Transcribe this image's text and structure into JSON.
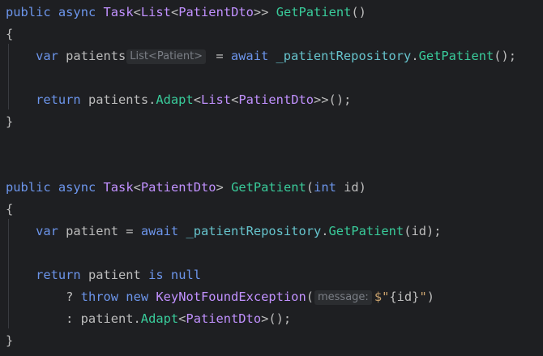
{
  "editor": {
    "lines": [
      [
        [
          "c-kw",
          "public"
        ],
        [
          "c-ns",
          " "
        ],
        [
          "c-kw",
          "async"
        ],
        [
          "c-ns",
          " "
        ],
        [
          "c-type",
          "Task"
        ],
        [
          "c-ns",
          "<"
        ],
        [
          "c-type",
          "List"
        ],
        [
          "c-ns",
          "<"
        ],
        [
          "c-type",
          "PatientDto"
        ],
        [
          "c-ns",
          ">> "
        ],
        [
          "c-method",
          "GetPatient"
        ],
        [
          "c-ns",
          "()"
        ]
      ],
      [
        [
          "c-ns",
          "{"
        ]
      ],
      [
        [
          "c-ns",
          "    "
        ],
        [
          "c-kw",
          "var"
        ],
        [
          "c-ns",
          " patients"
        ],
        [
          "hint",
          "List<Patient>"
        ],
        [
          "c-ns",
          " = "
        ],
        [
          "c-kw",
          "await"
        ],
        [
          "c-ns",
          " "
        ],
        [
          "c-field",
          "_patientRepository"
        ],
        [
          "c-ns",
          "."
        ],
        [
          "c-method",
          "GetPatient"
        ],
        [
          "c-ns",
          "();"
        ]
      ],
      [
        [
          "c-ns",
          ""
        ]
      ],
      [
        [
          "c-ns",
          "    "
        ],
        [
          "c-kw",
          "return"
        ],
        [
          "c-ns",
          " patients."
        ],
        [
          "c-method",
          "Adapt"
        ],
        [
          "c-ns",
          "<"
        ],
        [
          "c-type",
          "List"
        ],
        [
          "c-ns",
          "<"
        ],
        [
          "c-type",
          "PatientDto"
        ],
        [
          "c-ns",
          ">>();"
        ]
      ],
      [
        [
          "c-ns",
          "}"
        ]
      ],
      [
        [
          "c-ns",
          ""
        ]
      ],
      [
        [
          "c-ns",
          ""
        ]
      ],
      [
        [
          "c-kw",
          "public"
        ],
        [
          "c-ns",
          " "
        ],
        [
          "c-kw",
          "async"
        ],
        [
          "c-ns",
          " "
        ],
        [
          "c-type",
          "Task"
        ],
        [
          "c-ns",
          "<"
        ],
        [
          "c-type",
          "PatientDto"
        ],
        [
          "c-ns",
          "> "
        ],
        [
          "c-method",
          "GetPatient"
        ],
        [
          "c-ns",
          "("
        ],
        [
          "c-kw",
          "int"
        ],
        [
          "c-ns",
          " id)"
        ]
      ],
      [
        [
          "c-ns",
          "{"
        ]
      ],
      [
        [
          "c-ns",
          "    "
        ],
        [
          "c-kw",
          "var"
        ],
        [
          "c-ns",
          " patient = "
        ],
        [
          "c-kw",
          "await"
        ],
        [
          "c-ns",
          " "
        ],
        [
          "c-field",
          "_patientRepository"
        ],
        [
          "c-ns",
          "."
        ],
        [
          "c-method",
          "GetPatient"
        ],
        [
          "c-ns",
          "(id);"
        ]
      ],
      [
        [
          "c-ns",
          ""
        ]
      ],
      [
        [
          "c-ns",
          "    "
        ],
        [
          "c-kw",
          "return"
        ],
        [
          "c-ns",
          " patient "
        ],
        [
          "c-kw",
          "is"
        ],
        [
          "c-ns",
          " "
        ],
        [
          "c-kw",
          "null"
        ]
      ],
      [
        [
          "c-ns",
          "        ? "
        ],
        [
          "c-kw",
          "throw"
        ],
        [
          "c-ns",
          " "
        ],
        [
          "c-kw",
          "new"
        ],
        [
          "c-ns",
          " "
        ],
        [
          "c-type",
          "KeyNotFoundException"
        ],
        [
          "c-ns",
          "("
        ],
        [
          "hint",
          "message:"
        ],
        [
          "c-str",
          "$\""
        ],
        [
          "c-ns",
          "{id}"
        ],
        [
          "c-str",
          "\""
        ],
        [
          "c-ns",
          ")"
        ]
      ],
      [
        [
          "c-ns",
          "        : patient."
        ],
        [
          "c-method",
          "Adapt"
        ],
        [
          "c-ns",
          "<"
        ],
        [
          "c-type",
          "PatientDto"
        ],
        [
          "c-ns",
          ">();"
        ]
      ],
      [
        [
          "c-ns",
          "}"
        ]
      ]
    ]
  },
  "colors": {
    "background": "#1e1f22",
    "keyword": "#6c95eb",
    "type": "#c191ff",
    "method": "#39cc9b",
    "field": "#66c3cc",
    "string": "#c9a26d",
    "plain": "#bdbdbd",
    "hint_text": "#7a7e85",
    "hint_bg": "#2b2d30"
  }
}
